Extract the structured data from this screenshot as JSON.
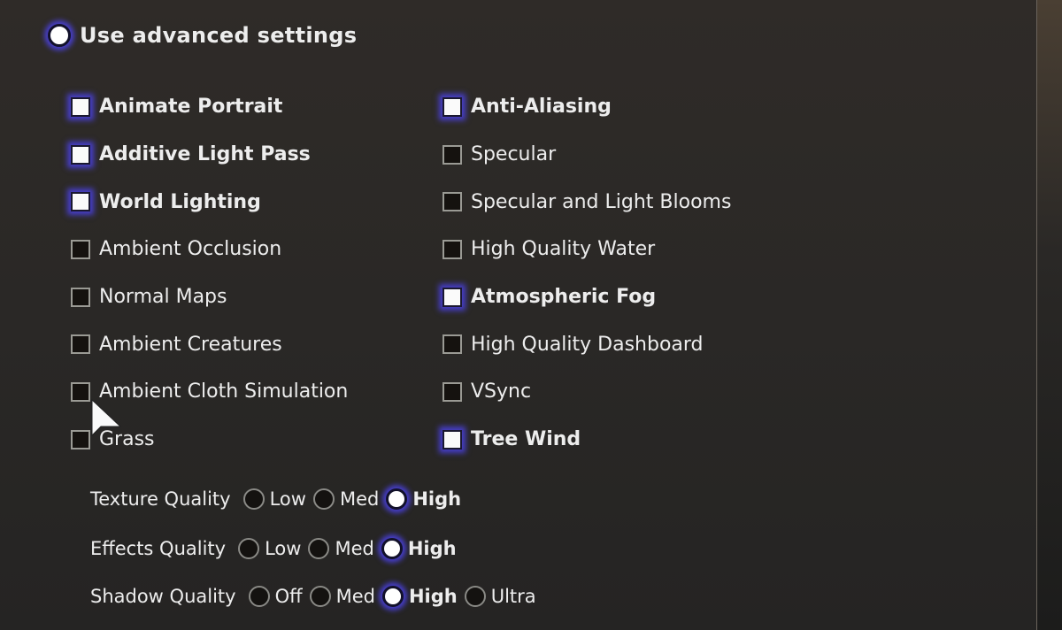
{
  "advanced": {
    "label": "Use advanced settings",
    "selected": true
  },
  "left_checkboxes": [
    {
      "label": "Animate Portrait",
      "checked": true
    },
    {
      "label": "Additive Light Pass",
      "checked": true
    },
    {
      "label": "World Lighting",
      "checked": true
    },
    {
      "label": "Ambient Occlusion",
      "checked": false
    },
    {
      "label": "Normal Maps",
      "checked": false
    },
    {
      "label": "Ambient Creatures",
      "checked": false
    },
    {
      "label": "Ambient Cloth Simulation",
      "checked": false
    },
    {
      "label": "Grass",
      "checked": false
    }
  ],
  "right_checkboxes": [
    {
      "label": "Anti-Aliasing",
      "checked": true
    },
    {
      "label": "Specular",
      "checked": false
    },
    {
      "label": "Specular and Light Blooms",
      "checked": false
    },
    {
      "label": "High Quality Water",
      "checked": false
    },
    {
      "label": "Atmospheric Fog",
      "checked": true
    },
    {
      "label": "High Quality Dashboard",
      "checked": false
    },
    {
      "label": "VSync",
      "checked": false
    },
    {
      "label": "Tree Wind",
      "checked": true
    }
  ],
  "quality": [
    {
      "label": "Texture Quality",
      "options": [
        "Low",
        "Med",
        "High"
      ],
      "selected": "High"
    },
    {
      "label": "Effects Quality",
      "options": [
        "Low",
        "Med",
        "High"
      ],
      "selected": "High"
    },
    {
      "label": "Shadow Quality",
      "options": [
        "Off",
        "Med",
        "High",
        "Ultra"
      ],
      "selected": "High"
    }
  ],
  "colors": {
    "highlight_glow": "#5046ff",
    "text": "#ededed",
    "background": "#2a2826"
  }
}
